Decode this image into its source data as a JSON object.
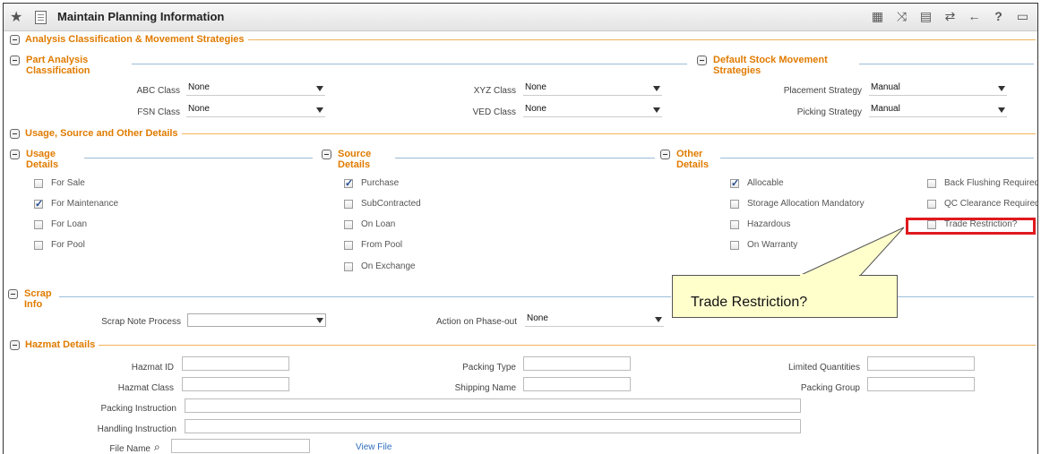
{
  "header": {
    "title": "Maintain Planning Information"
  },
  "sections": {
    "analysis": "Analysis Classification & Movement Strategies",
    "part_analysis": "Part Analysis\nClassification",
    "default_stock": "Default Stock Movement\nStrategies",
    "usage_source": "Usage, Source and Other Details",
    "usage_details": "Usage\nDetails",
    "source_details": "Source\nDetails",
    "other_details": "Other\nDetails",
    "scrap_info": "Scrap\nInfo",
    "hazmat": "Hazmat Details"
  },
  "fields": {
    "abc_label": "ABC Class",
    "abc_value": "None",
    "fsn_label": "FSN Class",
    "fsn_value": "None",
    "xyz_label": "XYZ Class",
    "xyz_value": "None",
    "ved_label": "VED Class",
    "ved_value": "None",
    "placement_label": "Placement Strategy",
    "placement_value": "Manual",
    "picking_label": "Picking Strategy",
    "picking_value": "Manual",
    "scrap_note_label": "Scrap Note Process",
    "scrap_note_value": "",
    "phase_out_label": "Action on Phase-out",
    "phase_out_value": "None",
    "hazmat_id_label": "Hazmat ID",
    "hazmat_class_label": "Hazmat Class",
    "packing_type_label": "Packing Type",
    "shipping_name_label": "Shipping Name",
    "limited_qty_label": "Limited Quantities",
    "packing_group_label": "Packing Group",
    "packing_instr_label": "Packing Instruction",
    "handling_instr_label": "Handling Instruction",
    "file_name_label": "File Name",
    "view_file": "View File"
  },
  "usage": [
    {
      "label": "For Sale",
      "checked": false
    },
    {
      "label": "For Maintenance",
      "checked": true
    },
    {
      "label": "For Loan",
      "checked": false
    },
    {
      "label": "For Pool",
      "checked": false
    }
  ],
  "source": [
    {
      "label": "Purchase",
      "checked": true
    },
    {
      "label": "SubContracted",
      "checked": false
    },
    {
      "label": "On Loan",
      "checked": false
    },
    {
      "label": "From Pool",
      "checked": false
    },
    {
      "label": "On Exchange",
      "checked": false
    }
  ],
  "other": [
    {
      "label": "Allocable",
      "checked": true
    },
    {
      "label": "Storage Allocation Mandatory",
      "checked": false
    },
    {
      "label": "Hazardous",
      "checked": false
    },
    {
      "label": "On Warranty",
      "checked": false
    }
  ],
  "other2": [
    {
      "label": "Back Flushing Required",
      "checked": false
    },
    {
      "label": "QC Clearance Required",
      "checked": false
    },
    {
      "label": "Trade Restriction?",
      "checked": false
    }
  ],
  "tooltip": {
    "text": "Trade Restriction?"
  }
}
